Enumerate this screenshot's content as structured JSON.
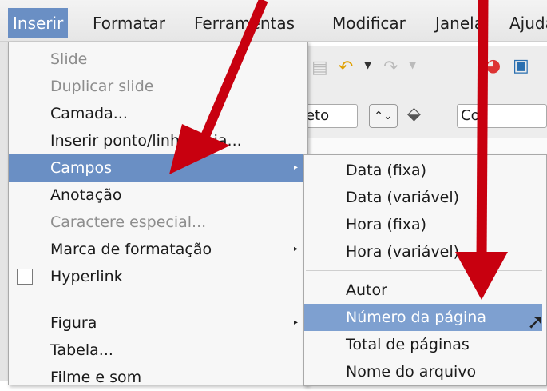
{
  "menubar": {
    "items": [
      {
        "label": "Inserir",
        "active": true
      },
      {
        "label": "Formatar"
      },
      {
        "label": "Ferramentas"
      },
      {
        "label": "Modificar"
      },
      {
        "label": "Janela"
      },
      {
        "label": "Ajuda"
      }
    ]
  },
  "insert_menu": {
    "items": [
      {
        "label": "Slide",
        "disabled": true
      },
      {
        "label": "Duplicar slide",
        "disabled": true
      },
      {
        "label": "Camada..."
      },
      {
        "label": "Inserir ponto/linha-guia..."
      },
      {
        "label": "Campos",
        "highlighted": true,
        "submenu": true
      },
      {
        "label": "Anotação"
      },
      {
        "label": "Caractere especial...",
        "disabled": true
      },
      {
        "label": "Marca de formatação",
        "submenu": true
      },
      {
        "label": "Hyperlink",
        "checkbox": false
      },
      {
        "label": "Figura",
        "submenu": true
      },
      {
        "label": "Tabela..."
      },
      {
        "label": "Filme e som"
      }
    ]
  },
  "fields_submenu": {
    "items": [
      {
        "label": "Data (fixa)"
      },
      {
        "label": "Data (variável)"
      },
      {
        "label": "Hora (fixa)"
      },
      {
        "label": "Hora (variável)"
      },
      {
        "label": "Autor"
      },
      {
        "label": "Número da página",
        "highlighted": true
      },
      {
        "label": "Total de páginas"
      },
      {
        "label": "Nome do arquivo"
      }
    ]
  },
  "toolbar": {
    "style_combo_value": "eto",
    "color_combo_value": "Cor"
  },
  "colors": {
    "menu_highlight": "#6a8fc4",
    "submenu_highlight": "#7ea0d0",
    "arrow": "#c8000f"
  }
}
